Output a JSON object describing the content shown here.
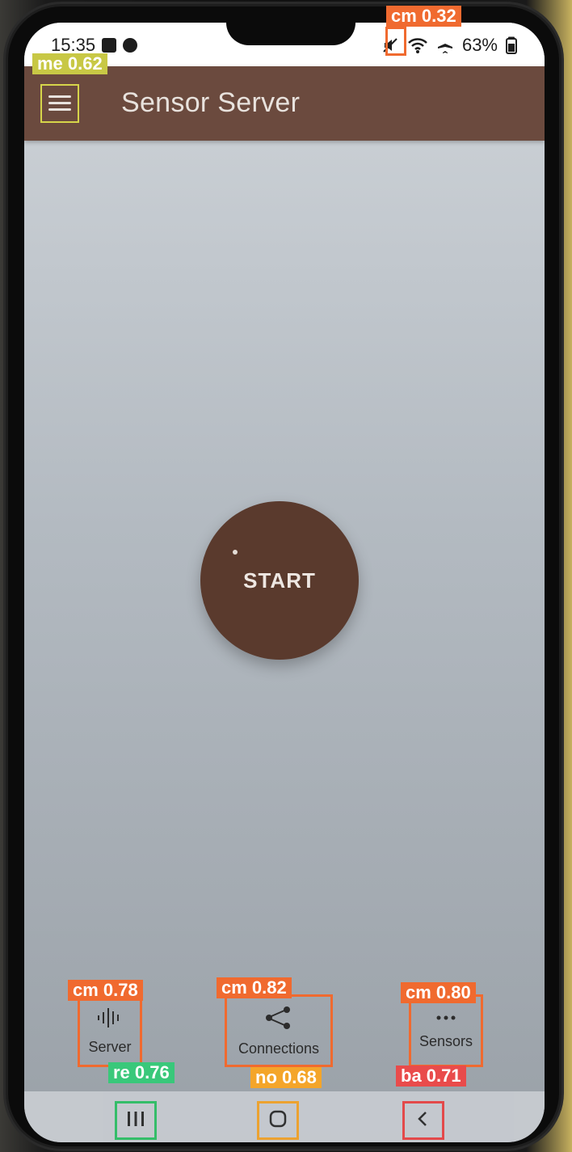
{
  "status_bar": {
    "time": "15:35",
    "battery": "63%",
    "icons": [
      "checkbox-icon",
      "alarm-icon",
      "mute-icon",
      "wifi-icon",
      "airplane-icon",
      "battery-icon"
    ]
  },
  "app_bar": {
    "title": "Sensor Server",
    "menu_icon": "hamburger-menu-icon",
    "background_color": "#6b4a3e"
  },
  "main": {
    "start_button_label": "START",
    "start_button_color": "#5a3a2d"
  },
  "bottom_nav": {
    "items": [
      {
        "label": "Server",
        "icon": "waveform-icon"
      },
      {
        "label": "Connections",
        "icon": "share-network-icon"
      },
      {
        "label": "Sensors",
        "icon": "more-horizontal-icon"
      }
    ]
  },
  "system_nav": {
    "recent_icon": "recent-apps-icon",
    "home_icon": "home-icon",
    "back_icon": "back-icon"
  },
  "detections": [
    {
      "text": "cm 0.32"
    },
    {
      "text": "me 0.62"
    },
    {
      "text": "cm 0.78"
    },
    {
      "text": "cm 0.82"
    },
    {
      "text": "cm 0.80"
    },
    {
      "text": "re 0.76"
    },
    {
      "text": "no 0.68"
    },
    {
      "text": "ba 0.71"
    }
  ]
}
